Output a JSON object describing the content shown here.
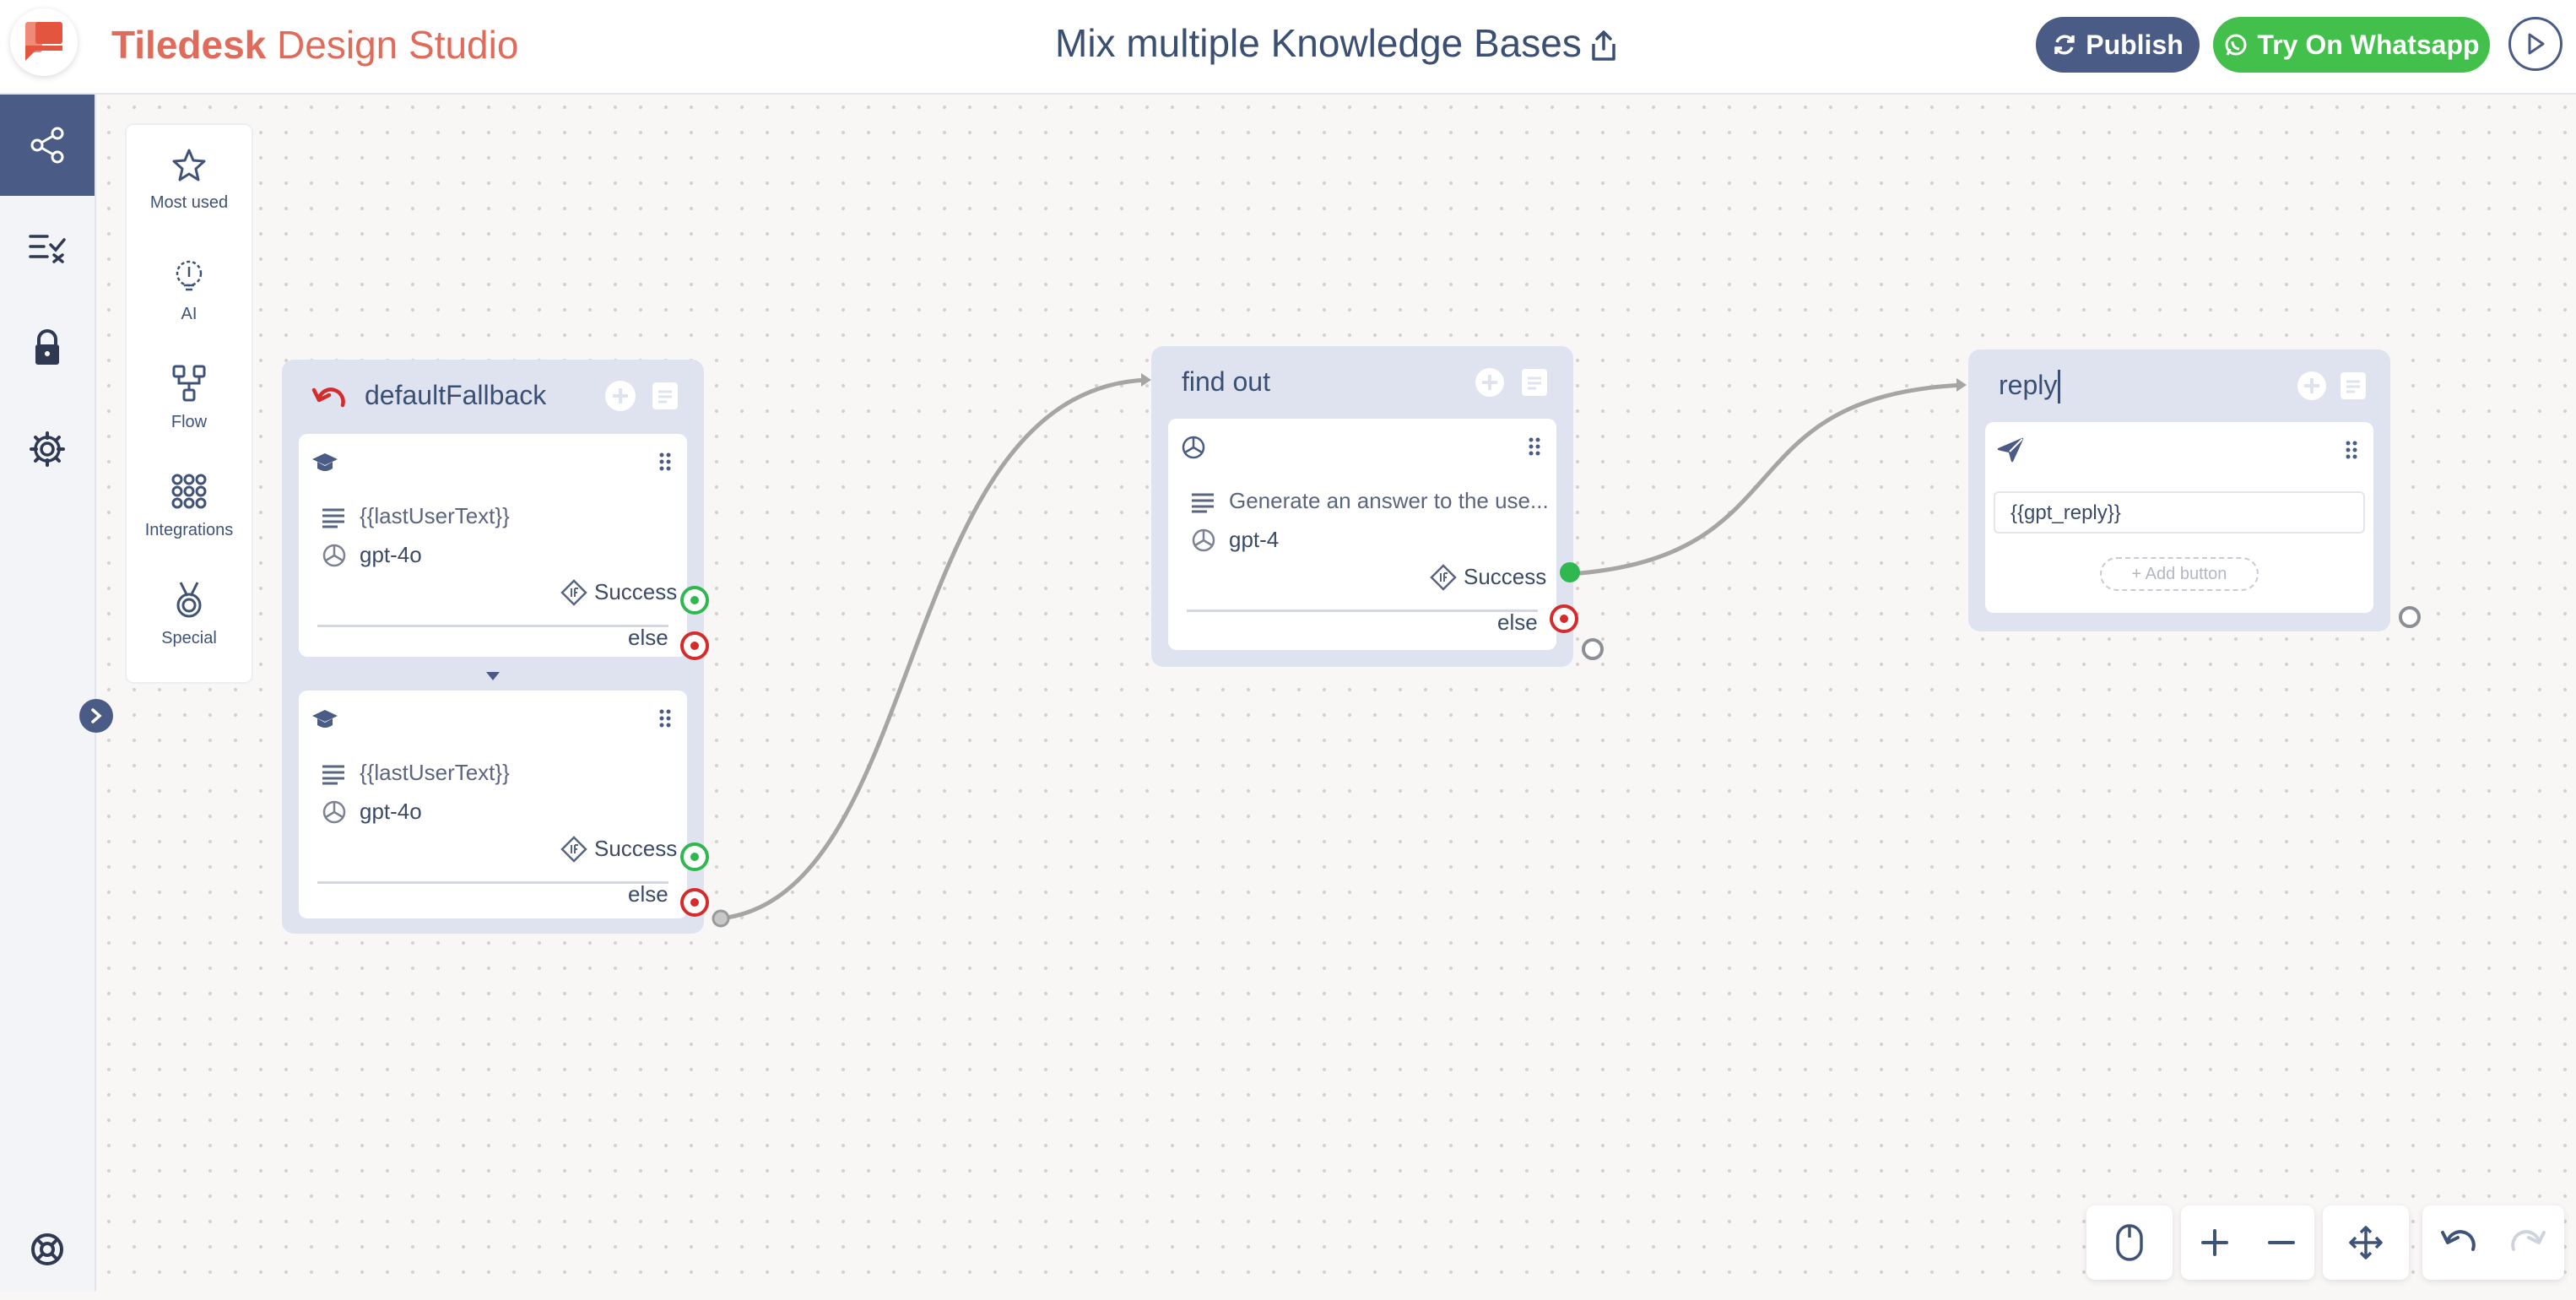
{
  "header": {
    "brand_bold": "Tiledesk",
    "brand_light": "Design Studio",
    "project_title": "Mix multiple Knowledge Bases",
    "publish_label": "Publish",
    "whatsapp_label": "Try On Whatsapp"
  },
  "palette": {
    "items": [
      {
        "label": "Most used",
        "icon": "star-icon"
      },
      {
        "label": "AI",
        "icon": "ai-bulb-icon"
      },
      {
        "label": "Flow",
        "icon": "flow-icon"
      },
      {
        "label": "Integrations",
        "icon": "integrations-grid-icon"
      },
      {
        "label": "Special",
        "icon": "medal-icon"
      }
    ]
  },
  "blocks": {
    "default_fallback": {
      "title": "defaultFallback",
      "cards": [
        {
          "question": "{{lastUserText}}",
          "model": "gpt-4o",
          "success": "Success",
          "else": "else"
        },
        {
          "question": "{{lastUserText}}",
          "model": "gpt-4o",
          "success": "Success",
          "else": "else"
        }
      ]
    },
    "find_out": {
      "title": "find out",
      "question": "Generate an answer to the use...",
      "model": "gpt-4",
      "success": "Success",
      "else": "else"
    },
    "reply": {
      "title": "reply",
      "message": "{{gpt_reply}}",
      "add_button": "+ Add button"
    }
  },
  "colors": {
    "brand": "#e06b5a",
    "primary": "#4a5b86",
    "whatsapp": "#43c04b",
    "success": "#2fb84f",
    "error": "#d52b2b"
  }
}
